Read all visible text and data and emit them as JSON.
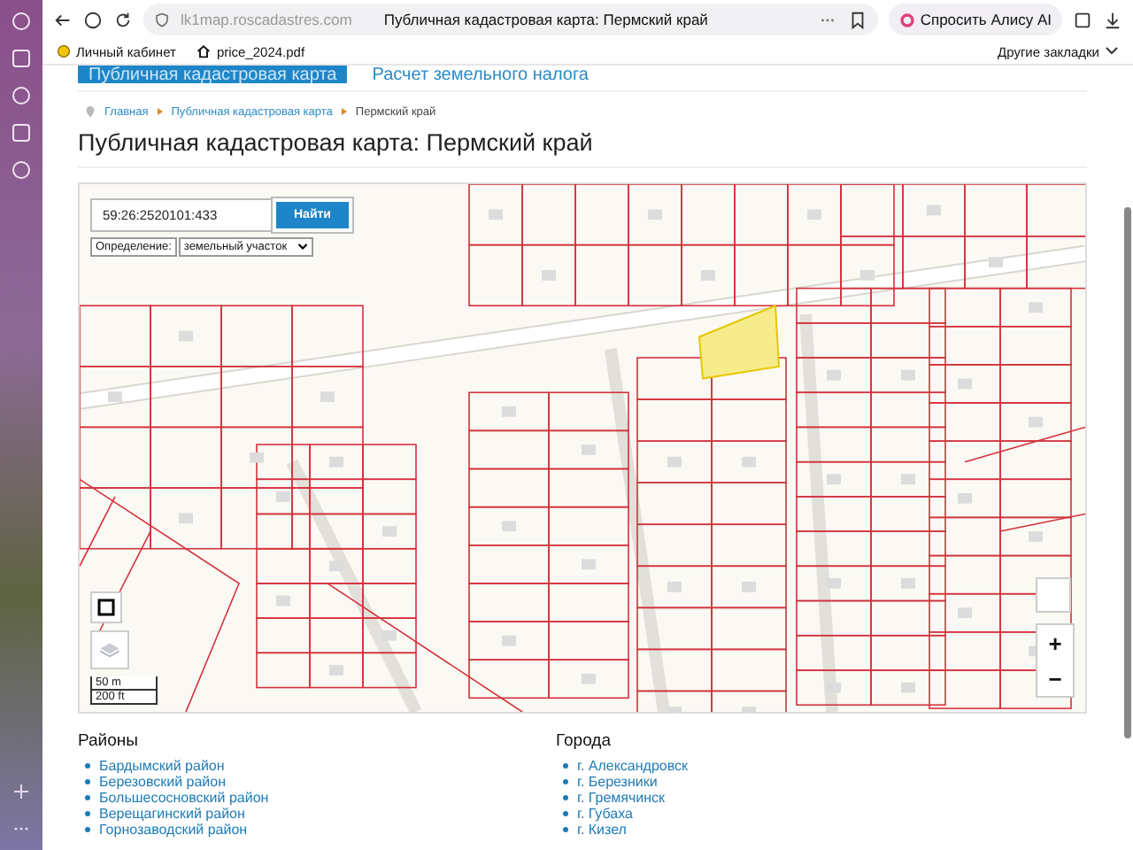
{
  "browser": {
    "address": "lk1map.roscadastres.com",
    "page_title": "Публичная кадастровая карта: Пермский край",
    "alice_button": "Спросить Алису AI"
  },
  "bookmarks": [
    {
      "label": "Личный кабинет",
      "kind": "dot"
    },
    {
      "label": "price_2024.pdf",
      "kind": "home"
    }
  ],
  "other_bookmarks": "Другие закладки",
  "nav_tabs": [
    {
      "label": "Публичная кадастровая карта",
      "selected": true
    },
    {
      "label": "Расчет земельного налога",
      "selected": false
    }
  ],
  "breadcrumbs": [
    "Главная",
    "Публичная кадастровая карта",
    "Пермский край"
  ],
  "title": "Публичная кадастровая карта: Пермский край",
  "map": {
    "search_value": "59:26:2520101:433",
    "search_button": "Найти",
    "mode_label": "Определение:",
    "mode_value": "земельный участок",
    "scale": [
      "50 m",
      "200 ft"
    ],
    "zoom_in": "+",
    "zoom_out": "−"
  },
  "districts": {
    "heading": "Районы",
    "items": [
      "Бардымский район",
      "Березовский район",
      "Большесосновский район",
      "Верещагинский район",
      "Горнозаводский район"
    ]
  },
  "cities": {
    "heading": "Города",
    "items": [
      "г. Александровск",
      "г. Березники",
      "г. Гремячинск",
      "г. Губаха",
      "г. Кизел"
    ]
  }
}
